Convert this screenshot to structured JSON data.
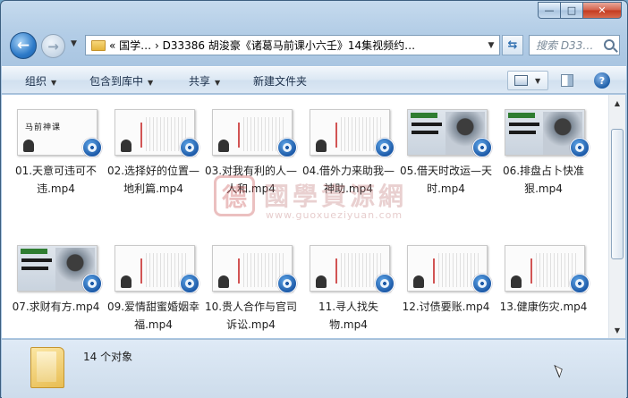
{
  "window": {
    "caption": {
      "minimize_glyph": "—",
      "maximize_glyph": "□",
      "close_glyph": "✕"
    }
  },
  "nav": {
    "back_icon": "back-arrow-icon",
    "forward_icon": "forward-arrow-icon",
    "address": "« 国学… › D33386 胡浚豪《诸葛马前课小六壬》14集视频约…",
    "search_placeholder": "搜索 D33…"
  },
  "toolbar": {
    "organize": "组织",
    "include_library": "包含到库中",
    "share": "共享",
    "new_folder": "新建文件夹"
  },
  "files": [
    {
      "name": "01.天意可违可不违.mp4",
      "thumb": "intro",
      "thumb_title": "马前神课"
    },
    {
      "name": "02.选择好的位置—地利篇.mp4",
      "thumb": "lines"
    },
    {
      "name": "03.对我有利的人—人和.mp4",
      "thumb": "lines"
    },
    {
      "name": "04.借外力来助我—神助.mp4",
      "thumb": "lines"
    },
    {
      "name": "05.借天时改运—天时.mp4",
      "thumb": "card"
    },
    {
      "name": "06.排盘占卜快准狠.mp4",
      "thumb": "card"
    },
    {
      "name": "07.求财有方.mp4",
      "thumb": "card"
    },
    {
      "name": "09.爱情甜蜜婚姻幸福.mp4",
      "thumb": "lines"
    },
    {
      "name": "10.贵人合作与官司诉讼.mp4",
      "thumb": "lines"
    },
    {
      "name": "11.寻人找失物.mp4",
      "thumb": "lines"
    },
    {
      "name": "12.讨债要账.mp4",
      "thumb": "lines"
    },
    {
      "name": "13.健康伤灾.mp4",
      "thumb": "lines"
    }
  ],
  "watermark": {
    "seal": "德",
    "text": "國學資源網",
    "url": "www.guoxueziyuan.com"
  },
  "status": {
    "count_text": "14 个对象"
  },
  "colors": {
    "accent": "#1d5aa8",
    "toolbar": "#dbe7f3",
    "close": "#c4391f"
  }
}
